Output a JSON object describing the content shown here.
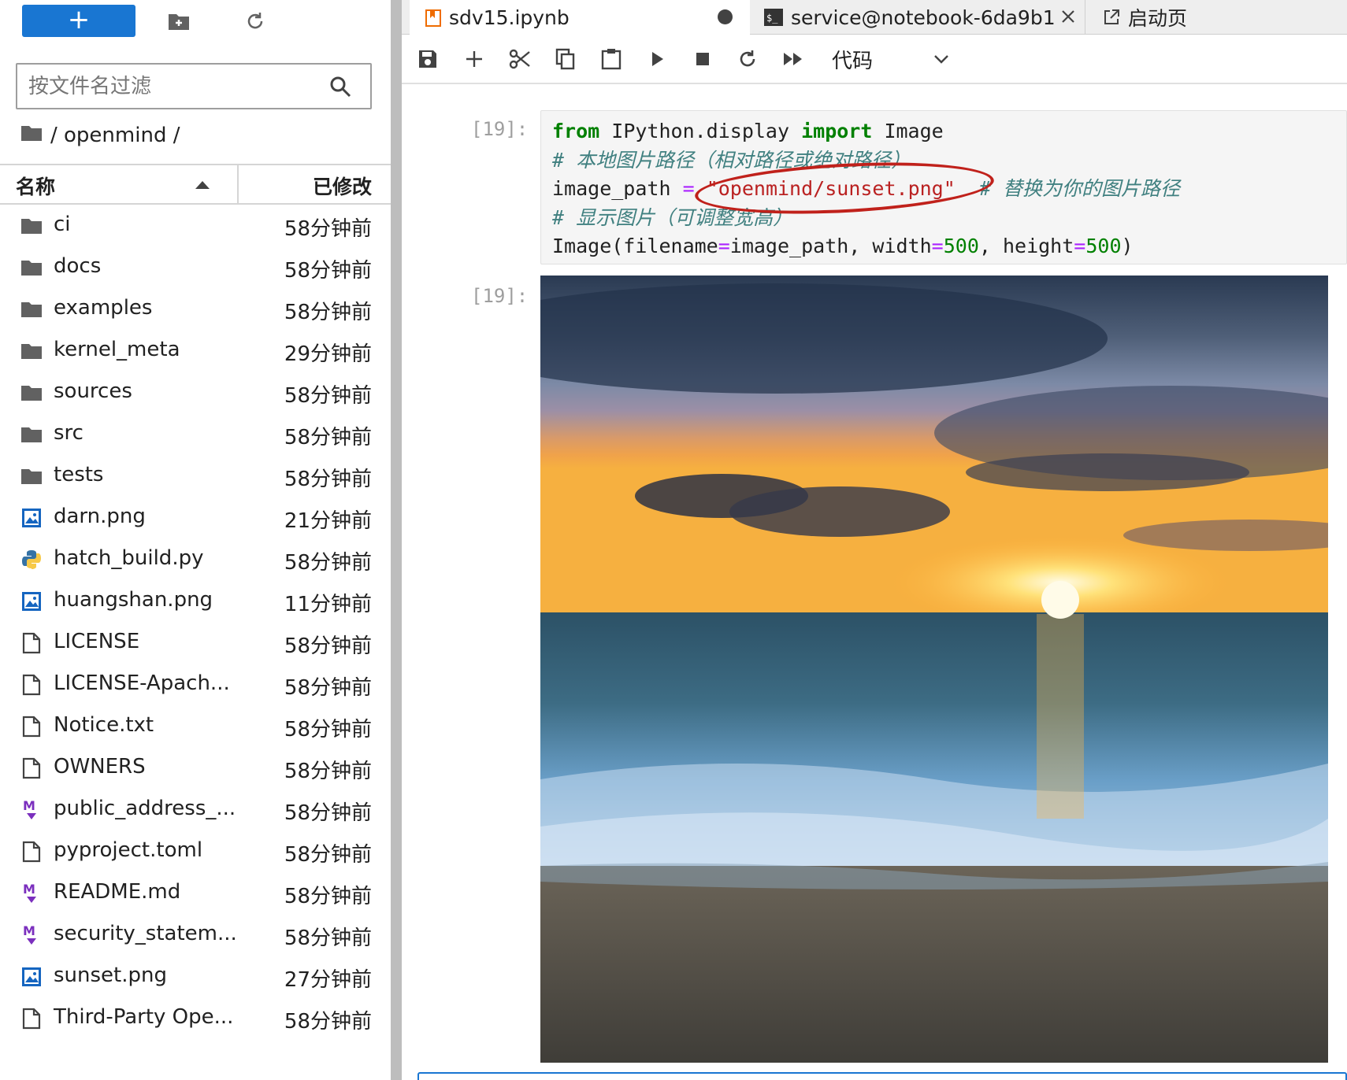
{
  "filebrowser": {
    "new_label": "+",
    "filter_placeholder": "按文件名过滤",
    "breadcrumb": "/ openmind /",
    "header": {
      "name": "名称",
      "modified": "已修改"
    },
    "items": [
      {
        "name": "ci",
        "modified": "58分钟前",
        "type": "folder"
      },
      {
        "name": "docs",
        "modified": "58分钟前",
        "type": "folder"
      },
      {
        "name": "examples",
        "modified": "58分钟前",
        "type": "folder"
      },
      {
        "name": "kernel_meta",
        "modified": "29分钟前",
        "type": "folder"
      },
      {
        "name": "sources",
        "modified": "58分钟前",
        "type": "folder"
      },
      {
        "name": "src",
        "modified": "58分钟前",
        "type": "folder"
      },
      {
        "name": "tests",
        "modified": "58分钟前",
        "type": "folder"
      },
      {
        "name": "darn.png",
        "modified": "21分钟前",
        "type": "image"
      },
      {
        "name": "hatch_build.py",
        "modified": "58分钟前",
        "type": "python"
      },
      {
        "name": "huangshan.png",
        "modified": "11分钟前",
        "type": "image"
      },
      {
        "name": "LICENSE",
        "modified": "58分钟前",
        "type": "file"
      },
      {
        "name": "LICENSE-Apach...",
        "modified": "58分钟前",
        "type": "file"
      },
      {
        "name": "Notice.txt",
        "modified": "58分钟前",
        "type": "file"
      },
      {
        "name": "OWNERS",
        "modified": "58分钟前",
        "type": "file"
      },
      {
        "name": "public_address_...",
        "modified": "58分钟前",
        "type": "markdown"
      },
      {
        "name": "pyproject.toml",
        "modified": "58分钟前",
        "type": "file"
      },
      {
        "name": "README.md",
        "modified": "58分钟前",
        "type": "markdown"
      },
      {
        "name": "security_statem...",
        "modified": "58分钟前",
        "type": "markdown"
      },
      {
        "name": "sunset.png",
        "modified": "27分钟前",
        "type": "image"
      },
      {
        "name": "Third-Party Ope...",
        "modified": "58分钟前",
        "type": "file"
      }
    ]
  },
  "tabs": [
    {
      "label": "sdv15.ipynb",
      "icon": "notebook-icon"
    },
    {
      "label": "service@notebook-6da9b1",
      "icon": "terminal-icon"
    },
    {
      "label": "启动页",
      "icon": "launcher-icon"
    }
  ],
  "toolbar": {
    "cell_type": "代码"
  },
  "cells": {
    "input_prompt": "[19]:",
    "output_prompt": "[19]:",
    "code": {
      "l1_kw1": "from",
      "l1_mid": " IPython.display ",
      "l1_kw2": "import",
      "l1_end": " Image",
      "l2": "# 本地图片路径（相对路径或绝对路径）",
      "l3_var": "image_path ",
      "l3_op": "=",
      "l3_sp": " ",
      "l3_str": "\"openmind/sunset.png\"",
      "l3_cm": "  # 替换为你的图片路径",
      "l4": "# 显示图片（可调整宽高）",
      "l5_a": "Image(filename",
      "l5_op1": "=",
      "l5_b": "image_path, width",
      "l5_op2": "=",
      "l5_n1": "500",
      "l5_c": ", height",
      "l5_op3": "=",
      "l5_n2": "500",
      "l5_d": ")"
    }
  },
  "colors": {
    "accent": "#1976d2",
    "annotation": "#c0211b",
    "markdown_icon": "#7b2fbe",
    "image_icon": "#1565c0"
  }
}
